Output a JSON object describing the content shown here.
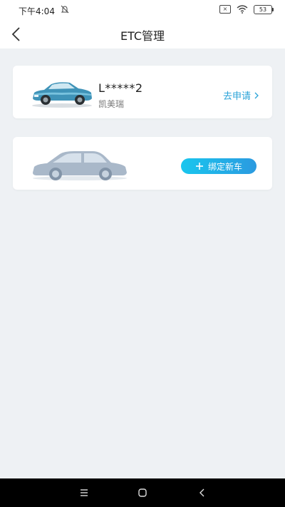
{
  "status_bar": {
    "time": "下午4:04",
    "battery": "53"
  },
  "nav": {
    "title": "ETC管理"
  },
  "vehicle": {
    "plate": "L*****2",
    "model": "凯美瑞",
    "apply_label": "去申请"
  },
  "add_vehicle": {
    "button_label": "绑定新车"
  },
  "colors": {
    "accent": "#2aa3d8",
    "button_gradient_start": "#19c6ee",
    "button_gradient_end": "#2b9ae0",
    "background": "#eef1f4"
  }
}
